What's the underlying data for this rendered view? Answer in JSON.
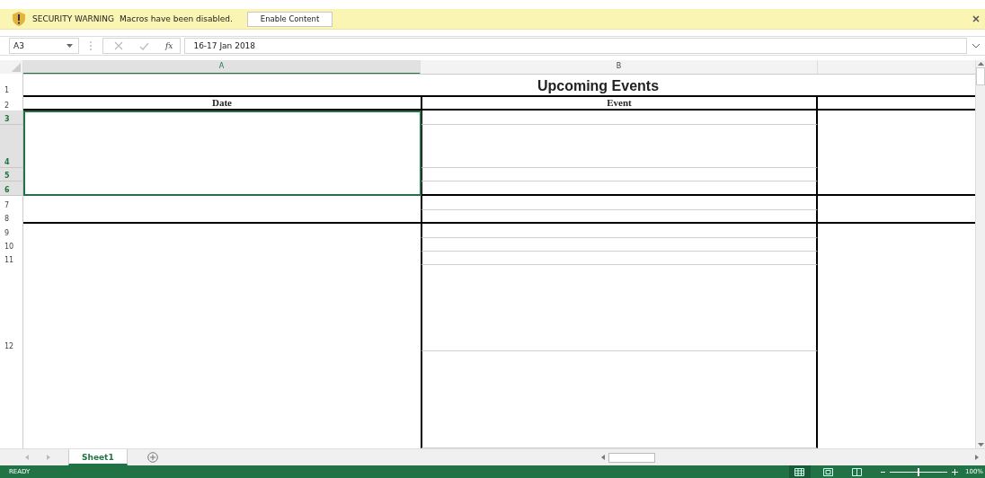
{
  "message_bar": {
    "title": "SECURITY WARNING",
    "message": "Macros have been disabled.",
    "button": "Enable Content"
  },
  "formula_bar": {
    "name_box": "A3",
    "function_label": "fx",
    "value": "16-17 Jan 2018"
  },
  "columns": [
    {
      "label": "A",
      "selected": true
    },
    {
      "label": "B",
      "selected": false
    }
  ],
  "rows": [
    {
      "label": "1",
      "selected": false
    },
    {
      "label": "2",
      "selected": false
    },
    {
      "label": "3",
      "selected": true
    },
    {
      "label": "4",
      "selected": true
    },
    {
      "label": "5",
      "selected": true
    },
    {
      "label": "6",
      "selected": true
    },
    {
      "label": "7",
      "selected": false
    },
    {
      "label": "8",
      "selected": false
    },
    {
      "label": "9",
      "selected": false
    },
    {
      "label": "10",
      "selected": false
    },
    {
      "label": "11",
      "selected": false
    },
    {
      "label": "12",
      "selected": false
    }
  ],
  "title_cell": "Upcoming Events",
  "headers": [
    "Date",
    "Event"
  ],
  "sheet_tabs": [
    {
      "label": "Sheet1",
      "selected": true
    }
  ],
  "status_bar": {
    "mode": "READY",
    "views": [
      {
        "kind": "normal",
        "selected": true
      },
      {
        "kind": "page_layout",
        "selected": false
      },
      {
        "kind": "page_break",
        "selected": false
      }
    ],
    "zoom_slider": {
      "level": 0.5
    },
    "zoom": "100%"
  }
}
